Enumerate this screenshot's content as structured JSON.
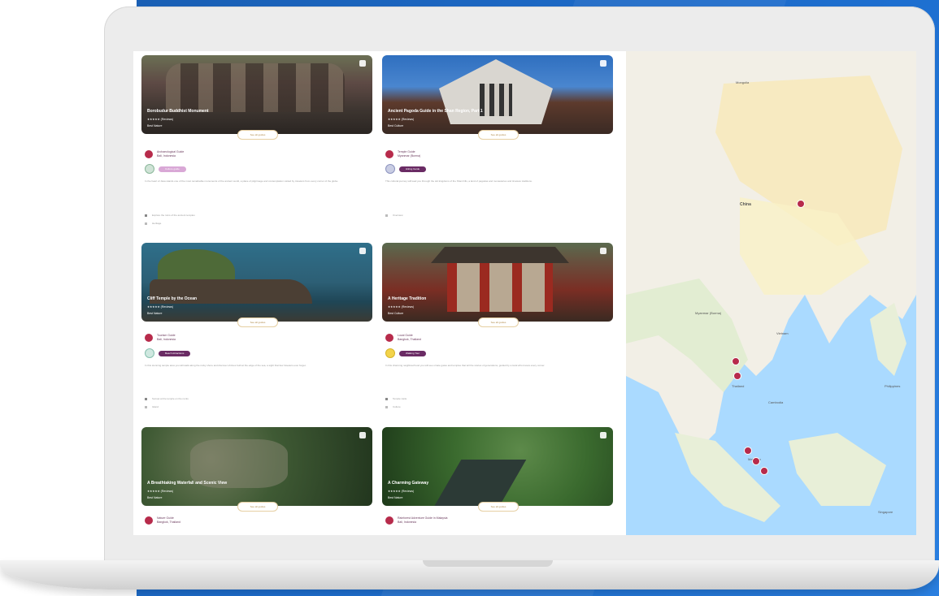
{
  "cards": [
    {
      "title": "Borobudur Buddhist Monument",
      "rating": "★★★★★  (Reviews)",
      "subtitle": "Best Nature",
      "pill": "See all guides",
      "guide": "Archaeological Guide",
      "location": "Bali, Indonesia",
      "tag": "Culture guide",
      "description": "In the heart of Java stands one of the most remarkable monuments of the ancient world, a place of pilgrimage and contemplation visited by travelers from every corner of the globe.",
      "item1": "Explore the ruins of the ancient temples",
      "item2": "Heritage"
    },
    {
      "title": "Ancient Pagoda Guide in the Shan Region, Part 1",
      "rating": "★★★★★  (Reviews)",
      "subtitle": "Best Culture",
      "pill": "See all guides",
      "guide": "Temple Guide",
      "location": "Myanmar (Burma)",
      "tag": "Hiking Guide",
      "description": "This cultural journey will lead you through the old kingdoms of the Shan hills, a land of pagodas and monasteries and timeless traditions.",
      "item1": "Overview",
      "item2": ""
    },
    {
      "title": "Cliff Temple by the Ocean",
      "rating": "★★★★★  (Reviews)",
      "subtitle": "Best Nature",
      "pill": "See all guides",
      "guide": "Tourism Guide",
      "location": "Bali, Indonesia",
      "tag": "Beach Attractions",
      "description": "In this stunning temple area you will walk along the rocky shore and discover shrines built at the edge of the sea, a sight that few travelers ever forget.",
      "item1": "Sunset at the temple on the rocks",
      "item2": "Island"
    },
    {
      "title": "A Heritage Tradition",
      "rating": "★★★★★  (Reviews)",
      "subtitle": "Best Culture",
      "pill": "See all guides",
      "guide": "Local Guide",
      "location": "Bangkok, Thailand",
      "tag": "Walking Tour",
      "description": "In this charming neighbourhood you will see ornate gates and temples that tell the stories of generations, guided by a local who knows every corner.",
      "item1": "Temple visits",
      "item2": "Culture"
    },
    {
      "title": "A Breathtaking Waterfall and Scenic View",
      "rating": "★★★★★  (Reviews)",
      "subtitle": "Best Nature",
      "pill": "See all guides",
      "guide": "Nature Guide",
      "location": "Bangkok, Thailand",
      "tag": "",
      "description": "",
      "item1": "",
      "item2": ""
    },
    {
      "title": "A Charming Gateway",
      "rating": "★★★★★  (Reviews)",
      "subtitle": "Best Nature",
      "pill": "See all guides",
      "guide": "Rainforest Adventure Guide in Malaysia",
      "location": "Bali, Indonesia",
      "tag": "",
      "description": "",
      "item1": "",
      "item2": ""
    }
  ],
  "map": {
    "labels": [
      "Mongolia",
      "China",
      "Myanmar (Burma)",
      "Thailand",
      "Cambodia",
      "Malaysia",
      "Philippines",
      "Vietnam",
      "Singapore"
    ]
  },
  "colors": {
    "accent": "#b72b4b",
    "tag_purple": "#6a2b64",
    "pill_gold": "#e6cfa2",
    "map_land": "#f2efe6",
    "map_water": "#aadaff"
  }
}
